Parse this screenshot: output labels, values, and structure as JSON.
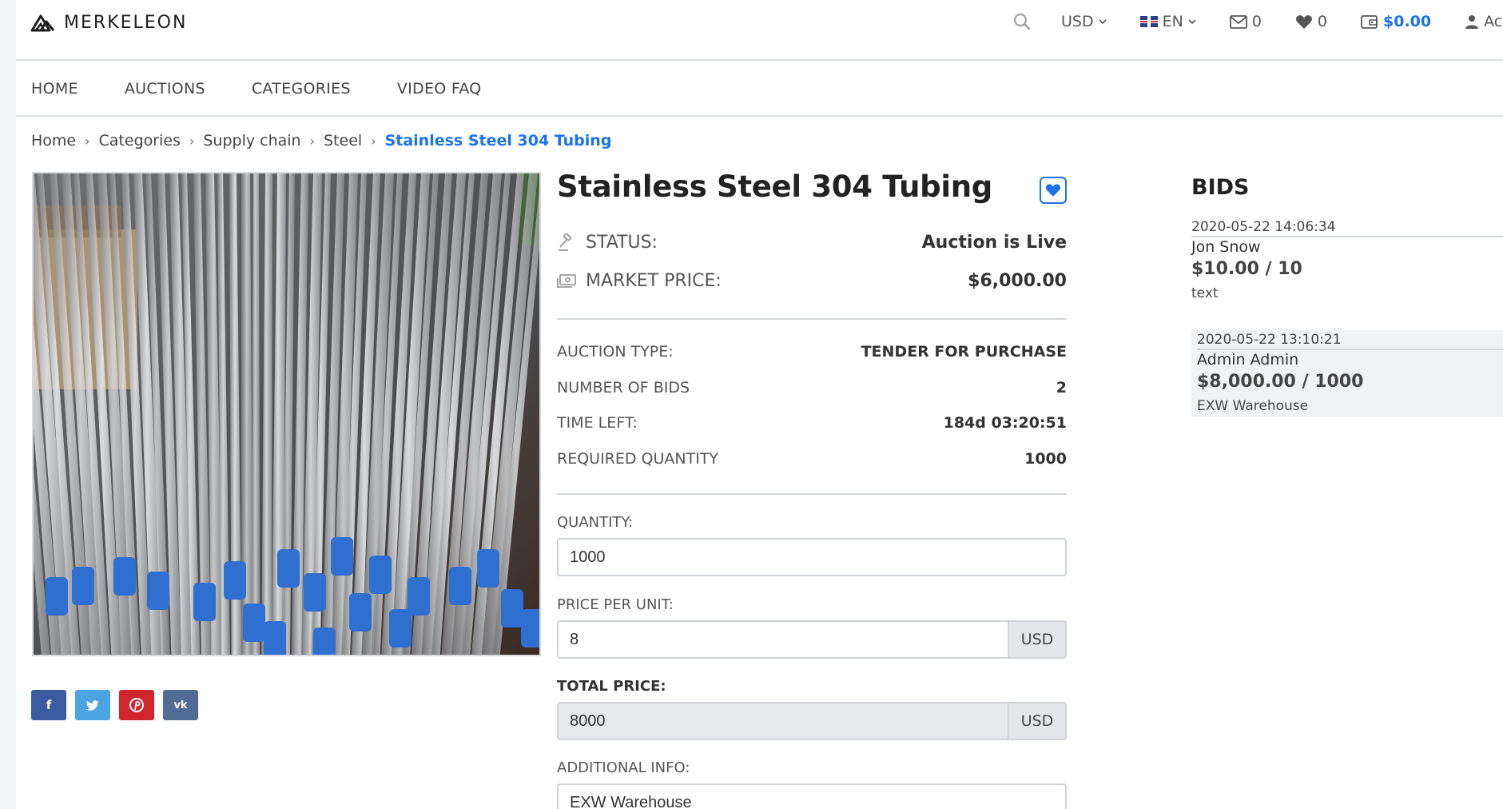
{
  "brand": {
    "name": "MERKELEON"
  },
  "header": {
    "currency": "USD",
    "language": "EN",
    "messages_count": "0",
    "favorites_count": "0",
    "wallet_balance": "$0.00",
    "account_label": "Ac"
  },
  "nav": {
    "items": [
      {
        "label": "HOME"
      },
      {
        "label": "AUCTIONS"
      },
      {
        "label": "CATEGORIES"
      },
      {
        "label": "VIDEO FAQ"
      }
    ]
  },
  "breadcrumb": {
    "items": [
      {
        "label": "Home"
      },
      {
        "label": "Categories"
      },
      {
        "label": "Supply chain"
      },
      {
        "label": "Steel"
      },
      {
        "label": "Stainless Steel 304 Tubing"
      }
    ]
  },
  "share": {
    "facebook": "f",
    "twitter": "t",
    "pinterest": "p",
    "vk": "vk"
  },
  "product": {
    "title": "Stainless Steel 304 Tubing",
    "status_label": "STATUS:",
    "status_value": "Auction is Live",
    "market_price_label": "MARKET PRICE:",
    "market_price_value": "$6,000.00",
    "auction_type_label": "AUCTION TYPE:",
    "auction_type_value": "TENDER FOR PURCHASE",
    "bids_count_label": "NUMBER OF BIDS",
    "bids_count_value": "2",
    "time_left_label": "TIME LEFT:",
    "time_left_value": "184d 03:20:51",
    "required_qty_label": "REQUIRED QUANTITY",
    "required_qty_value": "1000"
  },
  "form": {
    "quantity_label": "QUANTITY:",
    "quantity_value": "1000",
    "price_label": "PRICE PER UNIT:",
    "price_value": "8",
    "price_currency": "USD",
    "total_label": "TOTAL PRICE:",
    "total_value": "8000",
    "total_currency": "USD",
    "info_label": "ADDITIONAL INFO:",
    "info_value": "EXW Warehouse"
  },
  "bids": {
    "title": "BIDS",
    "list": [
      {
        "date": "2020-05-22 14:06:34",
        "name": "Jon Snow",
        "price": "$10.00 / 10",
        "note": "text"
      },
      {
        "date": "2020-05-22 13:10:21",
        "name": "Admin Admin",
        "price": "$8,000.00 / 1000",
        "note": "EXW Warehouse"
      }
    ]
  },
  "colors": {
    "accent": "#1a73e8",
    "facebook": "#3a5ba0",
    "twitter": "#4ba3e3",
    "pinterest": "#d0242f",
    "vk": "#4e6c94"
  }
}
